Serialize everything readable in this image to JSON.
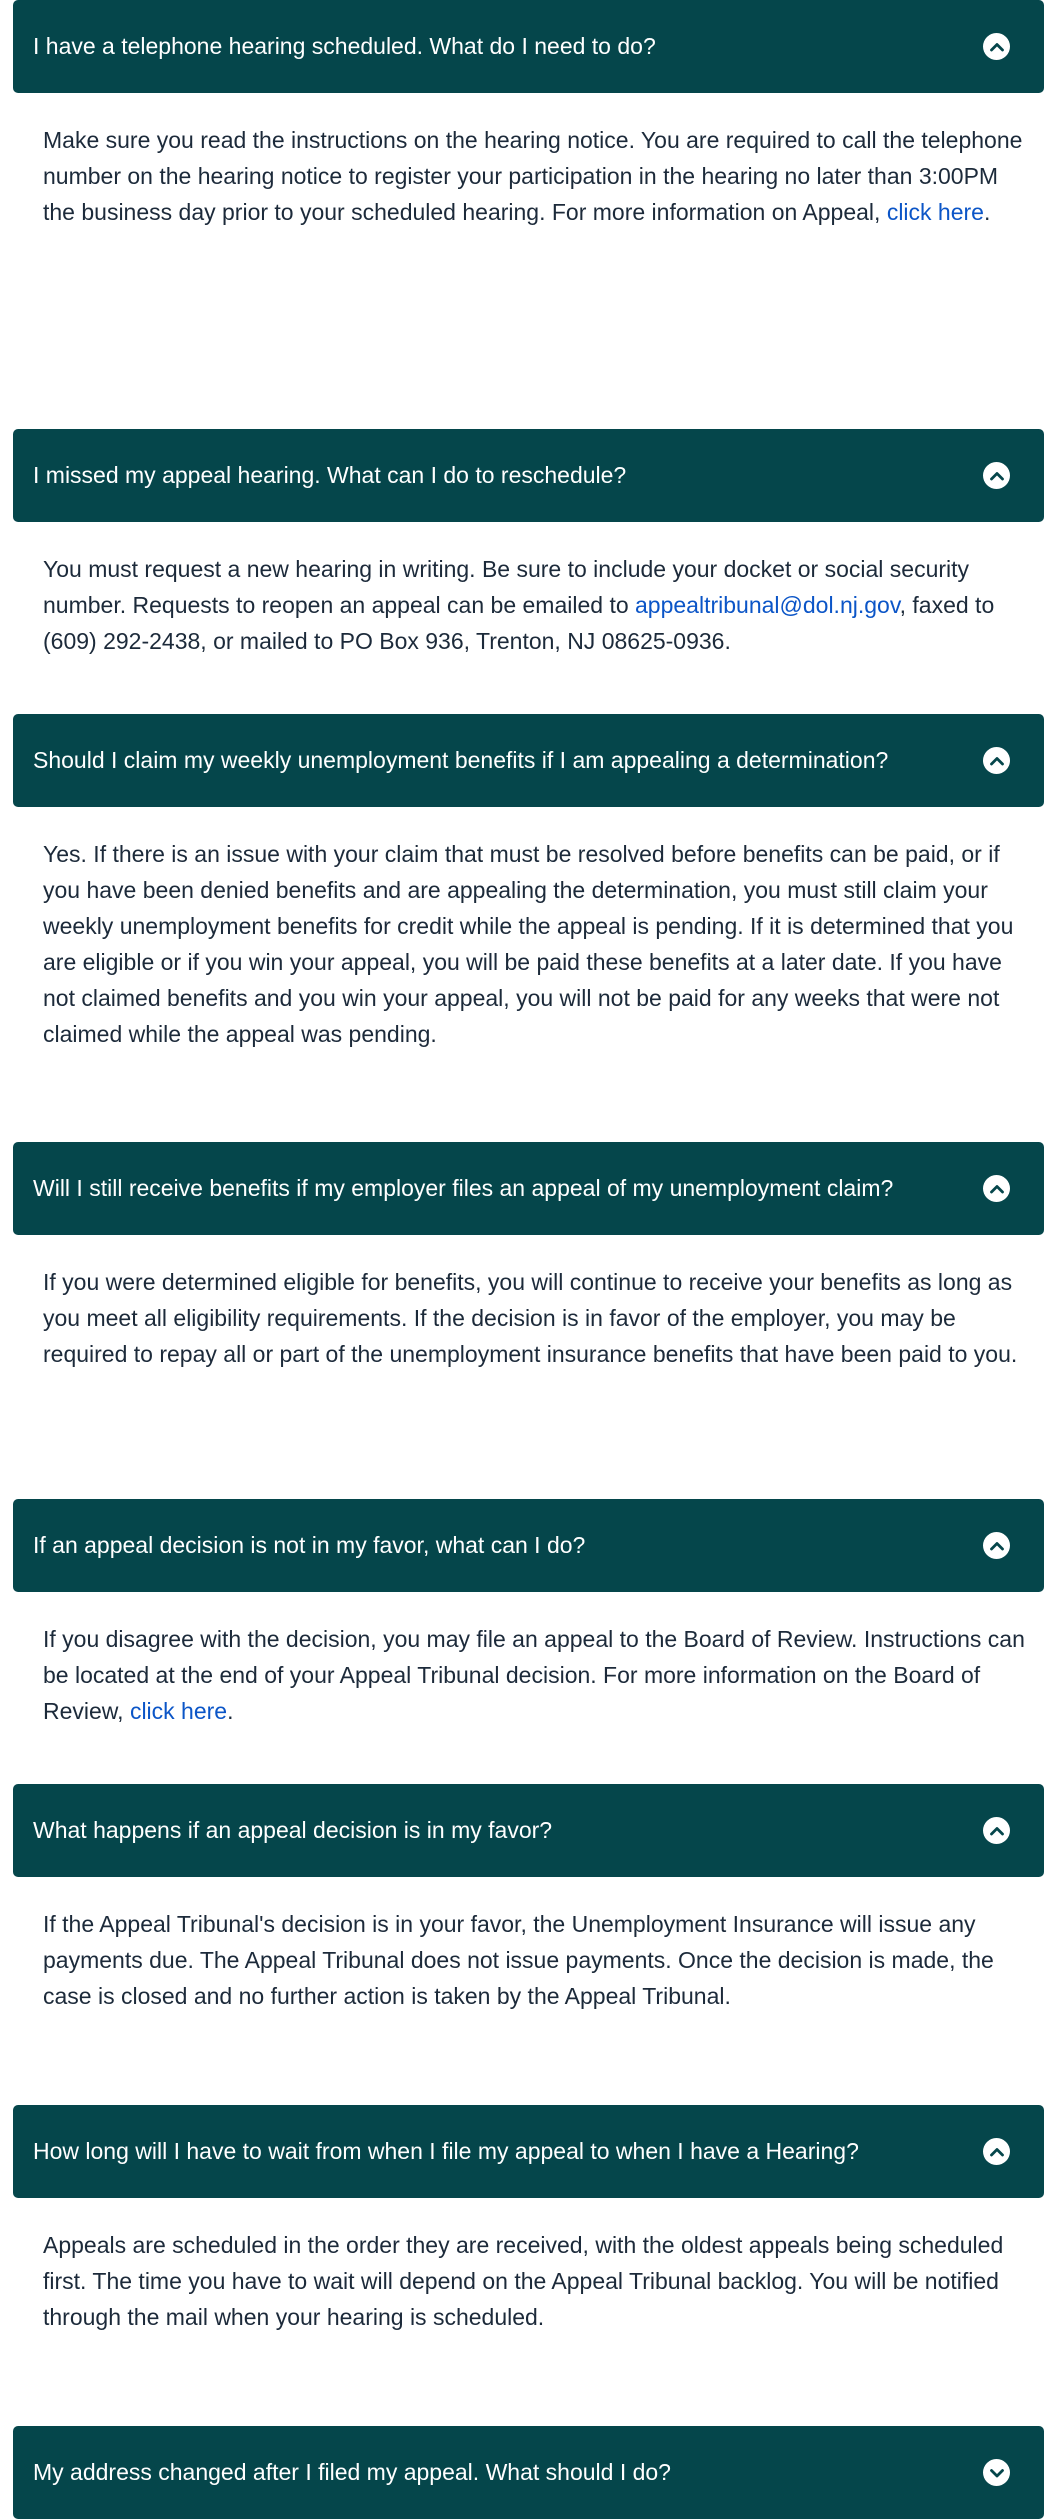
{
  "faqs": [
    {
      "question": "I have a telephone hearing scheduled. What do I need to do?",
      "icon": "chevron-up-icon",
      "expanded": true,
      "answer_before": "Make sure you read the instructions on the hearing notice. You are required to call the telephone number on the hearing notice to register your participation in the hearing no later than 3:00PM the business day prior to your scheduled hearing. For more information on Appeal, ",
      "answer_link": "click here",
      "answer_after": "."
    },
    {
      "question": "I missed my appeal hearing. What can I do to reschedule?",
      "icon": "chevron-up-icon",
      "expanded": true,
      "answer_before": "You must request a new hearing in writing. Be sure to include your docket or social security number. Requests to reopen an appeal can be emailed to ",
      "answer_link": "appealtribunal@dol.nj.gov",
      "answer_after": ", faxed to (609) 292-2438, or mailed to PO Box 936, Trenton, NJ 08625-0936."
    },
    {
      "question": "Should I claim my weekly unemployment benefits if I am appealing a determination?",
      "icon": "chevron-up-icon",
      "expanded": true,
      "answer_before": "Yes. If there is an issue with your claim that must be resolved before benefits can be paid, or if you have been denied benefits and are appealing the determination, you must still claim your weekly unemployment benefits for credit while the appeal is pending. If it is determined that you are eligible or if you win your appeal, you will be paid these benefits at a later date. If you have not claimed benefits and you win your appeal, you will not be paid for any weeks that were not claimed while the appeal was pending.",
      "answer_link": "",
      "answer_after": ""
    },
    {
      "question": "Will I still receive benefits if my employer files an appeal of my unemployment claim?",
      "icon": "chevron-up-icon",
      "expanded": true,
      "answer_before": "If you were determined eligible for benefits, you will continue to receive your benefits as long as you meet all eligibility requirements. If the decision is in favor of the employer, you may be required to repay all or part of the unemployment insurance benefits that have been paid to you.",
      "answer_link": "",
      "answer_after": ""
    },
    {
      "question": "If an appeal decision is not in my favor, what can I do?",
      "icon": "chevron-up-icon",
      "expanded": true,
      "answer_before": "If you disagree with the decision, you may file an appeal to the Board of Review. Instructions can be located at the end of your Appeal Tribunal decision. For more information on the Board of Review, ",
      "answer_link": "click here",
      "answer_after": "."
    },
    {
      "question": "What happens if an appeal decision is in my favor?",
      "icon": "chevron-up-icon",
      "expanded": true,
      "answer_before": "If the Appeal Tribunal's decision is in your favor, the Unemployment Insurance will issue any payments due. The Appeal Tribunal does not issue payments. Once the decision is made, the case is closed and no further action is taken by the Appeal Tribunal.",
      "answer_link": "",
      "answer_after": ""
    },
    {
      "question": "How long will I have to wait from when I file my appeal to when I have a Hearing?",
      "icon": "chevron-up-icon",
      "expanded": true,
      "answer_before": "Appeals are scheduled in the order they are received, with the oldest appeals being scheduled first. The time you have to wait will depend on the Appeal Tribunal backlog. You will be notified through the mail when your hearing is scheduled.",
      "answer_link": "",
      "answer_after": ""
    },
    {
      "question": "My address changed after I filed my appeal. What should I do?",
      "icon": "chevron-down-icon",
      "expanded": false,
      "answer_before": "",
      "answer_link": "",
      "answer_after": ""
    }
  ],
  "colors": {
    "header_bg": "#05464b",
    "header_text": "#ffffff",
    "body_text": "#1c2a3a",
    "link": "#0b55c7"
  }
}
